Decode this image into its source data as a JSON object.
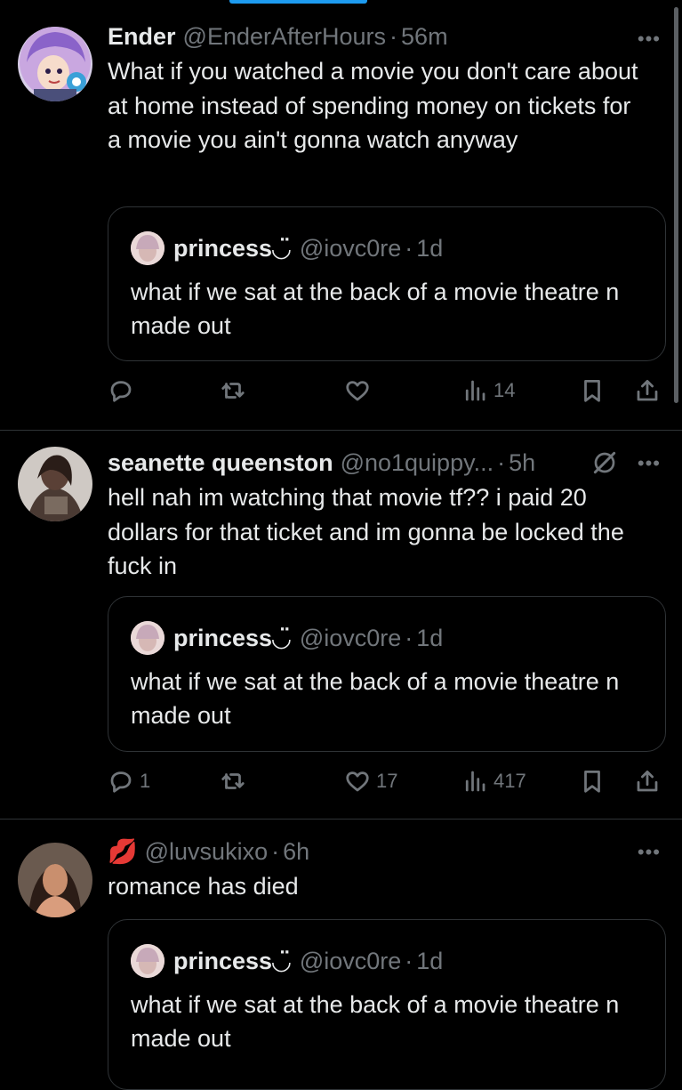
{
  "tweets": [
    {
      "name": "Ender",
      "handle": "@EnderAfterHours",
      "time": "56m",
      "text": "What if you watched a movie you don't care about at home instead of spending money on tickets for a movie you ain't gonna watch anyway",
      "quote": {
        "name": "princess◡̈",
        "handle": "@iovc0re",
        "time": "1d",
        "text": "what if we sat at the back of a movie theatre n made out"
      },
      "actions": {
        "replies": "",
        "retweets": "",
        "likes": "",
        "views": "14"
      }
    },
    {
      "name": "seanette queenston",
      "handle": "@no1quippy...",
      "time": "5h",
      "text": "hell nah im watching that movie tf?? i paid 20 dollars for that ticket and im gonna be locked the fuck in",
      "quote": {
        "name": "princess◡̈",
        "handle": "@iovc0re",
        "time": "1d",
        "text": "what if we sat at the back of a movie theatre n made out"
      },
      "actions": {
        "replies": "1",
        "retweets": "",
        "likes": "17",
        "views": "417"
      }
    },
    {
      "name": "💋",
      "handle": "@luvsukixo",
      "time": "6h",
      "text": "romance has died",
      "quote": {
        "name": "princess◡̈",
        "handle": "@iovc0re",
        "time": "1d",
        "text": "what if we sat at the back of a movie theatre n made out"
      }
    }
  ],
  "more_label": "•••",
  "dot": "·",
  "colors": {
    "background": "#000000",
    "text": "#e7e9ea",
    "muted": "#71767b",
    "border": "#2f3336",
    "accent": "#1d9bf0"
  }
}
